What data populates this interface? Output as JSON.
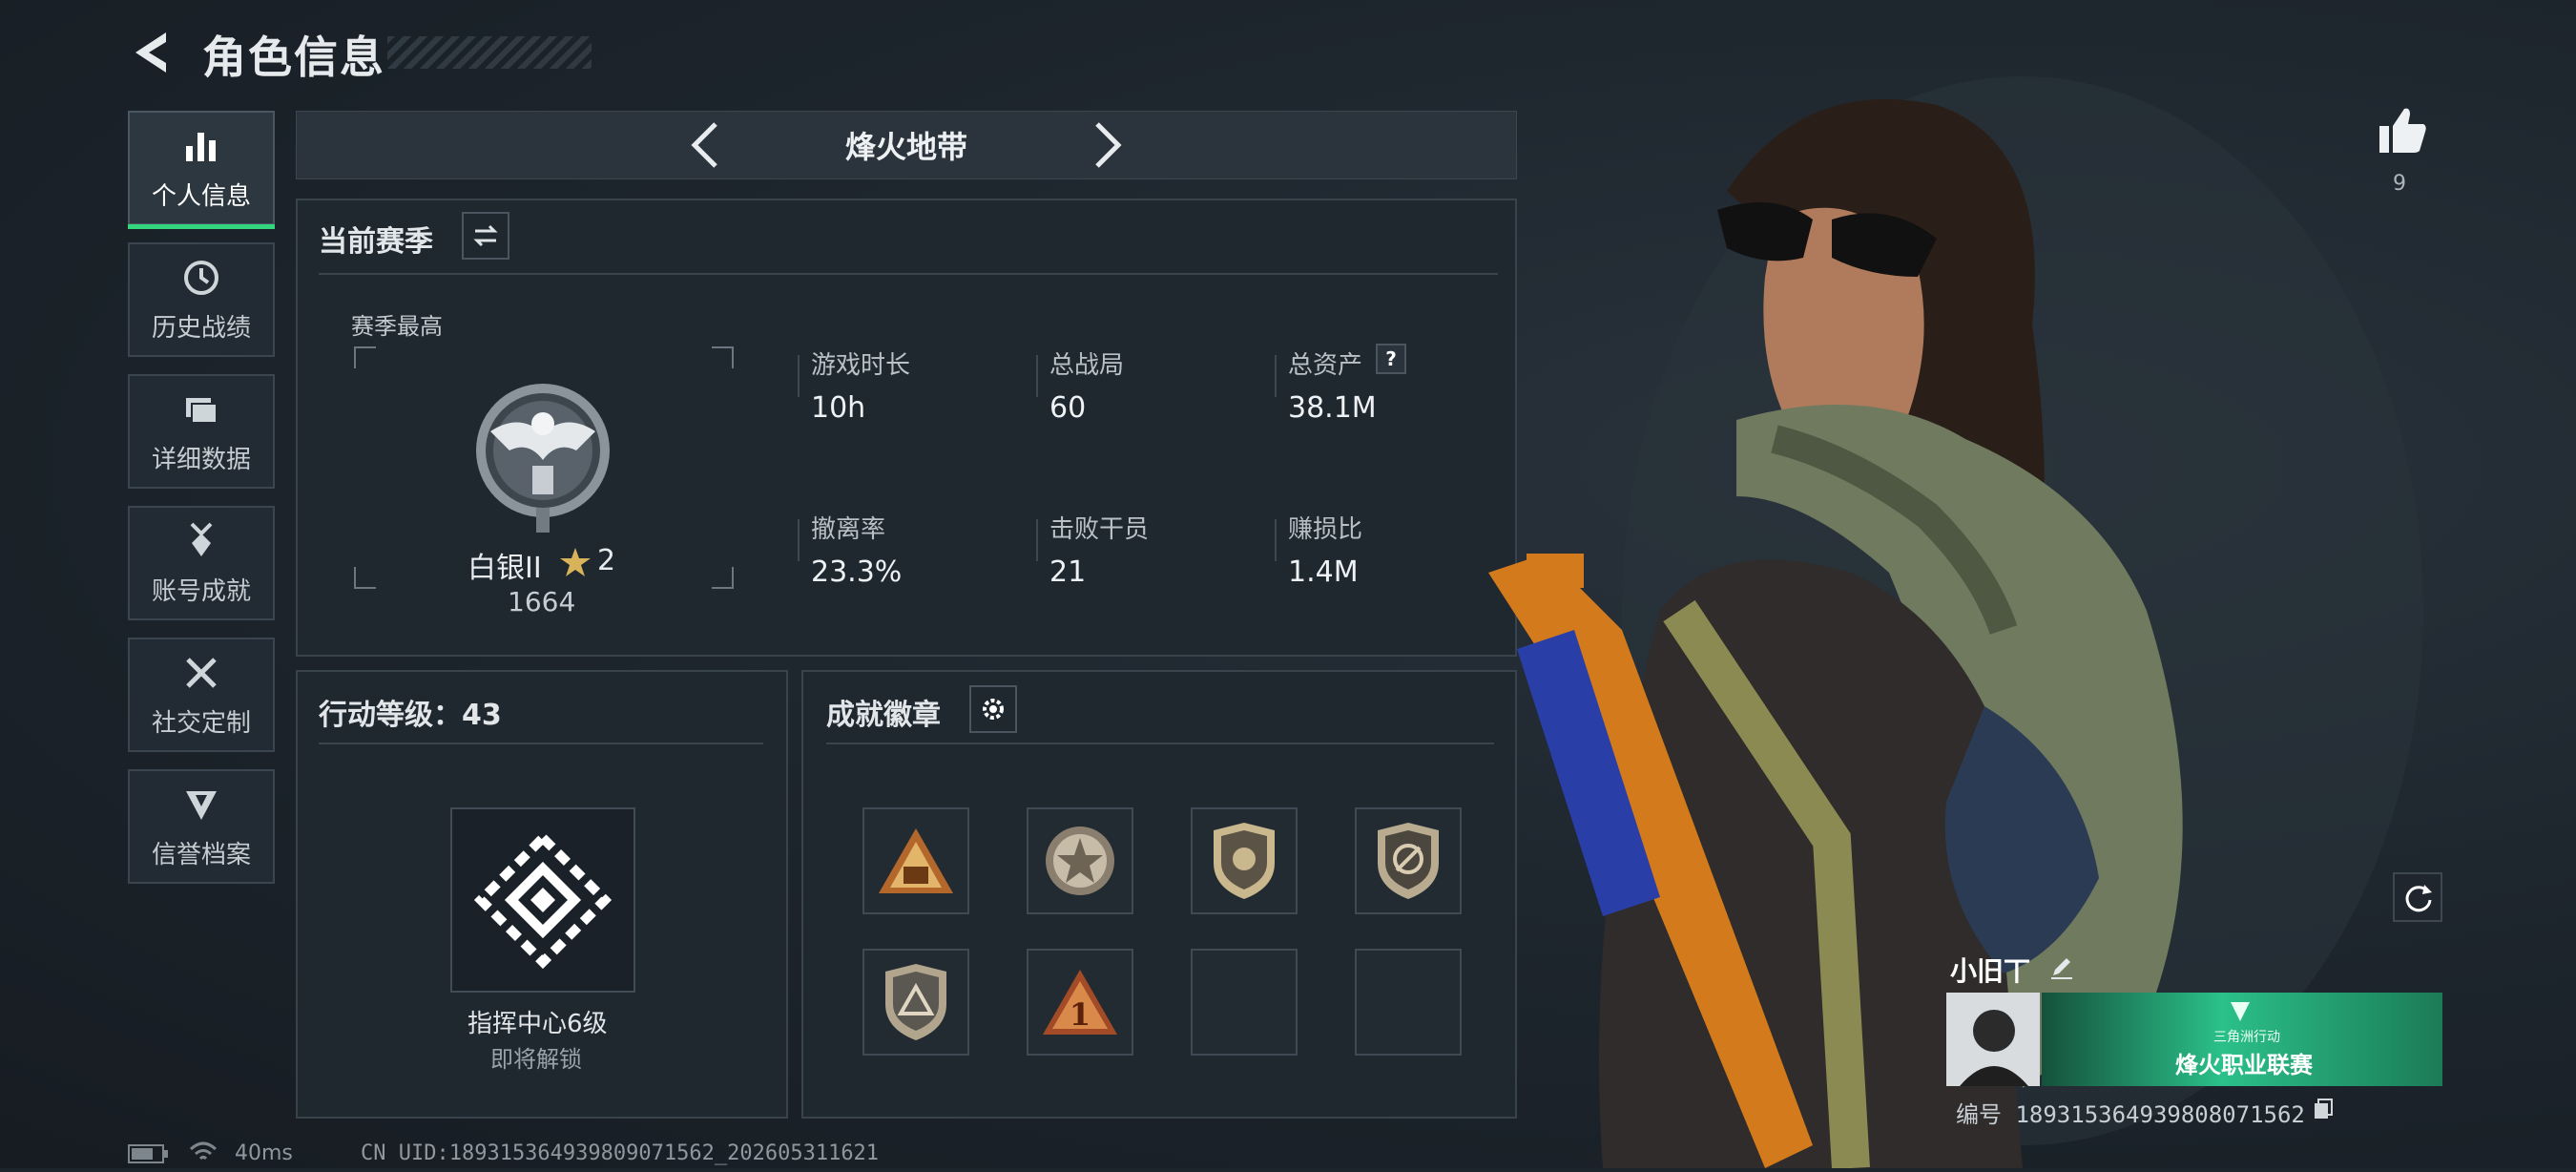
{
  "header": {
    "title": "角色信息"
  },
  "sidebar": {
    "items": [
      {
        "label": "个人信息",
        "icon": "bar-chart-icon"
      },
      {
        "label": "历史战绩",
        "icon": "clock-icon"
      },
      {
        "label": "详细数据",
        "icon": "folder-icon"
      },
      {
        "label": "账号成就",
        "icon": "medal-icon"
      },
      {
        "label": "社交定制",
        "icon": "tools-icon"
      },
      {
        "label": "信誉档案",
        "icon": "shield-v-icon"
      }
    ]
  },
  "mode": {
    "name": "烽火地带"
  },
  "season": {
    "title": "当前赛季",
    "best_label": "赛季最高",
    "rank_name": "白银II",
    "rank_stars": "2",
    "rank_score": "1664",
    "stats": [
      {
        "label": "游戏时长",
        "value": "10h"
      },
      {
        "label": "总战局",
        "value": "60"
      },
      {
        "label": "总资产",
        "value": "38.1M"
      },
      {
        "label": "撤离率",
        "value": "23.3%"
      },
      {
        "label": "击败干员",
        "value": "21"
      },
      {
        "label": "赚损比",
        "value": "1.4M"
      }
    ],
    "help": "?"
  },
  "level": {
    "title": "行动等级：43",
    "unlock_name": "指挥中心6级",
    "unlock_status": "即将解锁"
  },
  "achievements": {
    "title": "成就徽章"
  },
  "likes": {
    "count": "9"
  },
  "player": {
    "name": "小旧丅",
    "banner_line1": "三角洲行动",
    "banner_line2": "烽火职业联赛",
    "id_text": "编号 1893153649398080715​62"
  },
  "footer": {
    "ping": "40ms",
    "uid": "CN UID:189315364939809071562_202605311621"
  }
}
